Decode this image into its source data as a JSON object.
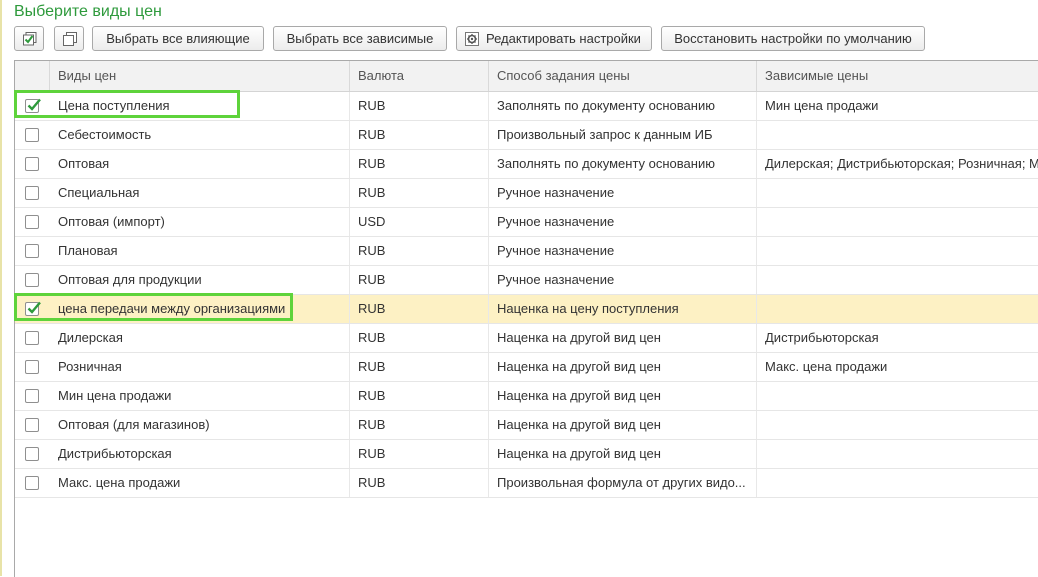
{
  "title": "Выберите виды цен",
  "toolbar": {
    "select_influencing": "Выбрать все влияющие",
    "select_dependent": "Выбрать все зависимые",
    "edit_settings": "Редактировать настройки",
    "restore_defaults": "Восстановить настройки по умолчанию"
  },
  "columns": [
    "Виды цен",
    "Валюта",
    "Способ задания цены",
    "Зависимые цены"
  ],
  "rows": [
    {
      "checked": true,
      "name": "Цена поступления",
      "currency": "RUB",
      "method": "Заполнять по документу основанию",
      "dependent": "Мин цена продажи"
    },
    {
      "checked": false,
      "name": "Себестоимость",
      "currency": "RUB",
      "method": "Произвольный запрос к данным ИБ",
      "dependent": ""
    },
    {
      "checked": false,
      "name": "Оптовая",
      "currency": "RUB",
      "method": "Заполнять по документу основанию",
      "dependent": "Дилерская; Дистрибьюторская; Розничная; М"
    },
    {
      "checked": false,
      "name": "Специальная",
      "currency": "RUB",
      "method": "Ручное назначение",
      "dependent": ""
    },
    {
      "checked": false,
      "name": "Оптовая (импорт)",
      "currency": "USD",
      "method": "Ручное назначение",
      "dependent": ""
    },
    {
      "checked": false,
      "name": "Плановая",
      "currency": "RUB",
      "method": "Ручное назначение",
      "dependent": ""
    },
    {
      "checked": false,
      "name": "Оптовая для продукции",
      "currency": "RUB",
      "method": "Ручное назначение",
      "dependent": ""
    },
    {
      "checked": true,
      "name": "цена передачи между организациями",
      "currency": "RUB",
      "method": "Наценка на цену поступления",
      "dependent": ""
    },
    {
      "checked": false,
      "name": "Дилерская",
      "currency": "RUB",
      "method": "Наценка на другой вид цен",
      "dependent": "Дистрибьюторская"
    },
    {
      "checked": false,
      "name": "Розничная",
      "currency": "RUB",
      "method": "Наценка на другой вид цен",
      "dependent": "Макс. цена продажи"
    },
    {
      "checked": false,
      "name": "Мин цена продажи",
      "currency": "RUB",
      "method": "Наценка на другой вид цен",
      "dependent": ""
    },
    {
      "checked": false,
      "name": "Оптовая (для магазинов)",
      "currency": "RUB",
      "method": "Наценка на другой вид цен",
      "dependent": ""
    },
    {
      "checked": false,
      "name": "Дистрибьюторская",
      "currency": "RUB",
      "method": "Наценка на другой вид цен",
      "dependent": ""
    },
    {
      "checked": false,
      "name": "Макс. цена продажи",
      "currency": "RUB",
      "method": "Произвольная формула от других видо...",
      "dependent": ""
    }
  ],
  "selected_row": 7,
  "colors": {
    "title": "#2e9a3c",
    "highlight": "#5ed33b",
    "selected_row": "#fdf1c4",
    "check": "#2e9a3c"
  }
}
